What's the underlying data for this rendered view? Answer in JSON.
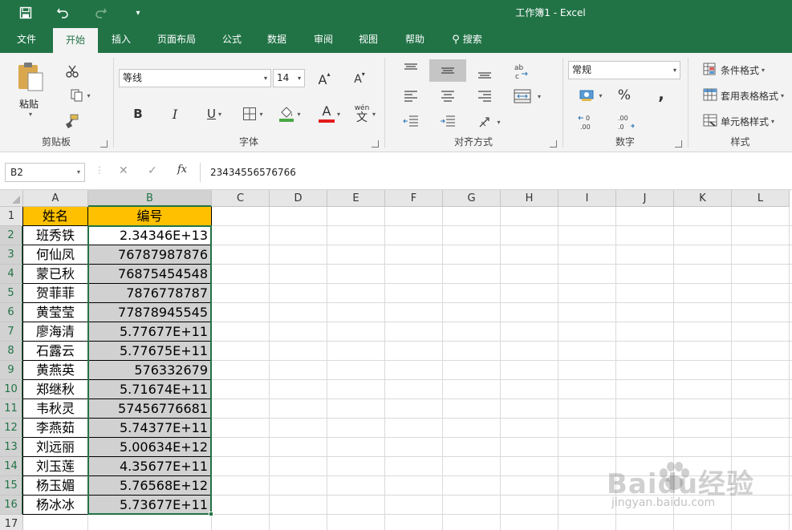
{
  "titlebar": {
    "title": "工作簿1  -  Excel",
    "qat": {
      "save_icon": "save-icon",
      "undo_icon": "undo-icon",
      "redo_icon": "redo-icon",
      "customize_icon": "qat-customize-icon"
    }
  },
  "tabs": [
    {
      "label": "文件"
    },
    {
      "label": "开始"
    },
    {
      "label": "插入"
    },
    {
      "label": "页面布局"
    },
    {
      "label": "公式"
    },
    {
      "label": "数据"
    },
    {
      "label": "审阅"
    },
    {
      "label": "视图"
    },
    {
      "label": "帮助"
    },
    {
      "label": "搜索"
    }
  ],
  "ribbon": {
    "clipboard": {
      "label": "剪贴板",
      "paste_label": "粘贴"
    },
    "font": {
      "label": "字体",
      "font_name": "等线",
      "font_size": "14",
      "bold": "B",
      "italic": "I",
      "underline": "U",
      "grow": "A",
      "shrink": "A",
      "font_color": "A",
      "phonetic": "wén",
      "phonetic_char": "文"
    },
    "alignment": {
      "label": "对齐方式"
    },
    "number": {
      "label": "数字",
      "format": "常规",
      "percent": "%",
      "comma": ","
    },
    "styles": {
      "label": "样式",
      "conditional": "条件格式",
      "table": "套用表格格式",
      "cell_styles": "单元格样式"
    }
  },
  "formula_bar": {
    "name_box": "B2",
    "cancel": "✕",
    "enter": "✓",
    "fx": "fx",
    "formula": "23434556576766"
  },
  "columns": [
    "A",
    "B",
    "C",
    "D",
    "E",
    "F",
    "G",
    "H",
    "I",
    "J",
    "K",
    "L"
  ],
  "rows": [
    "1",
    "2",
    "3",
    "4",
    "5",
    "6",
    "7",
    "8",
    "9",
    "10",
    "11",
    "12",
    "13",
    "14",
    "15",
    "16",
    "17"
  ],
  "table": {
    "header": {
      "name": "姓名",
      "id": "编号"
    },
    "rows": [
      {
        "name": "班秀铁",
        "id": "2.34346E+13"
      },
      {
        "name": "何仙凤",
        "id": "76787987876"
      },
      {
        "name": "蒙已秋",
        "id": "76875454548"
      },
      {
        "name": "贺菲菲",
        "id": "7876778787"
      },
      {
        "name": "黄莹莹",
        "id": "77878945545"
      },
      {
        "name": "廖海清",
        "id": "5.77677E+11"
      },
      {
        "name": "石露云",
        "id": "5.77675E+11"
      },
      {
        "name": "黄燕英",
        "id": "576332679"
      },
      {
        "name": "郑继秋",
        "id": "5.71674E+11"
      },
      {
        "name": "韦秋灵",
        "id": "57456776681"
      },
      {
        "name": "李燕茹",
        "id": "5.74377E+11"
      },
      {
        "name": "刘远丽",
        "id": "5.00634E+12"
      },
      {
        "name": "刘玉莲",
        "id": "4.35677E+11"
      },
      {
        "name": "杨玉媚",
        "id": "5.76568E+12"
      },
      {
        "name": "杨冰冰",
        "id": "5.73677E+11"
      }
    ]
  },
  "watermark": {
    "main": "Baidu经验",
    "sub": "jingyan.baidu.com"
  }
}
